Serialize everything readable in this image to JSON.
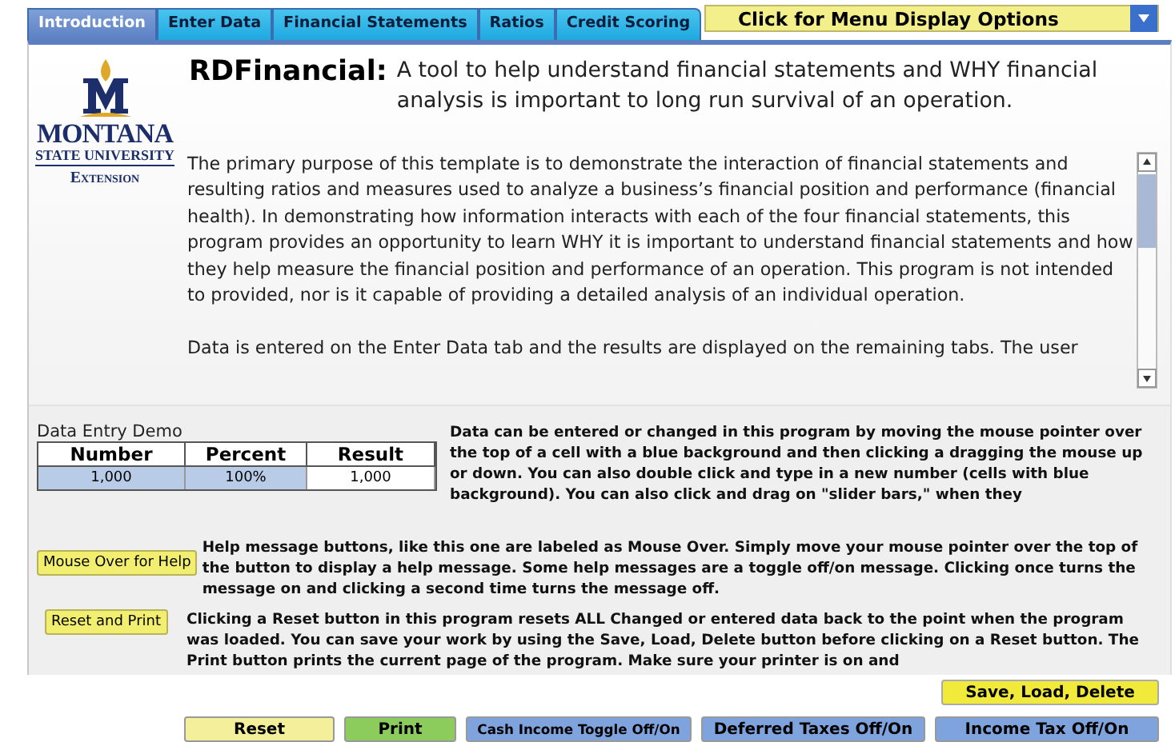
{
  "tabs": [
    {
      "label": "Introduction",
      "selected": true
    },
    {
      "label": "Enter Data",
      "selected": false
    },
    {
      "label": "Financial Statements",
      "selected": false
    },
    {
      "label": "Ratios",
      "selected": false
    },
    {
      "label": "Credit Scoring",
      "selected": false
    }
  ],
  "menu_dropdown": {
    "label": "Click for Menu Display Options"
  },
  "logo": {
    "name": "MONTANA",
    "line_2": "STATE UNIVERSITY",
    "line_3": "Extension"
  },
  "header": {
    "title": "RDFinancial:",
    "subtitle": "A tool to help understand financial statements and WHY financial analysis is important to long run survival of an operation."
  },
  "intro_text": {
    "paragraphs": [
      "The primary purpose of this template is to demonstrate the interaction of financial statements and resulting ratios and measures used to analyze a business’s financial position and performance (financial health).  In demonstrating how information interacts with each of the four financial statements, this program provides an opportunity to learn WHY it is important to understand financial statements and how they help measure the financial position and performance of an operation.  This program is not intended to provided, nor is it capable of providing a detailed analysis of an individual operation.",
      "Data is entered on the Enter Data tab and the results are displayed on the remaining tabs.  The user"
    ]
  },
  "demo": {
    "title": "Data Entry Demo",
    "columns": [
      "Number",
      "Percent",
      "Result"
    ],
    "row": [
      {
        "value": "1,000",
        "editable": true
      },
      {
        "value": "100%",
        "editable": true
      },
      {
        "value": "1,000",
        "editable": false
      }
    ],
    "text": "Data can be entered or changed in this program by moving the mouse pointer over the top of a cell with a blue background and then clicking a dragging the mouse up or down.  You can also double click and type in a new number (cells with blue background).  You can also click and drag on \"slider bars,\" when they"
  },
  "help": {
    "button": "Mouse Over for Help",
    "text": "Help message buttons, like this one are labeled as Mouse Over.  Simply move your mouse pointer over the top of the button to display a help message.  Some help messages are a toggle off/on message. Clicking once turns the message on and clicking a second time turns the message off."
  },
  "reset_help": {
    "button": "Reset and Print",
    "text": "Clicking a Reset button in this program resets ALL Changed or entered data back to the point when the program was loaded.  You can save your work by using the Save, Load, Delete button before clicking on a Reset button.  The Print button prints the current page of the program.  Make sure your printer is on and"
  },
  "save_button": {
    "label": "Save, Load, Delete",
    "color": "#f2ea3a"
  },
  "bottom_buttons": [
    {
      "label": "Reset",
      "color": "#f3ef9a"
    },
    {
      "label": "Print",
      "color": "#8ccc5c"
    },
    {
      "label": "Cash Income Toggle Off/On",
      "color": "#7fa3dc"
    },
    {
      "label": "Deferred Taxes Off/On",
      "color": "#7fa3dc"
    },
    {
      "label": "Income Tax Off/On",
      "color": "#7fa3dc"
    }
  ]
}
